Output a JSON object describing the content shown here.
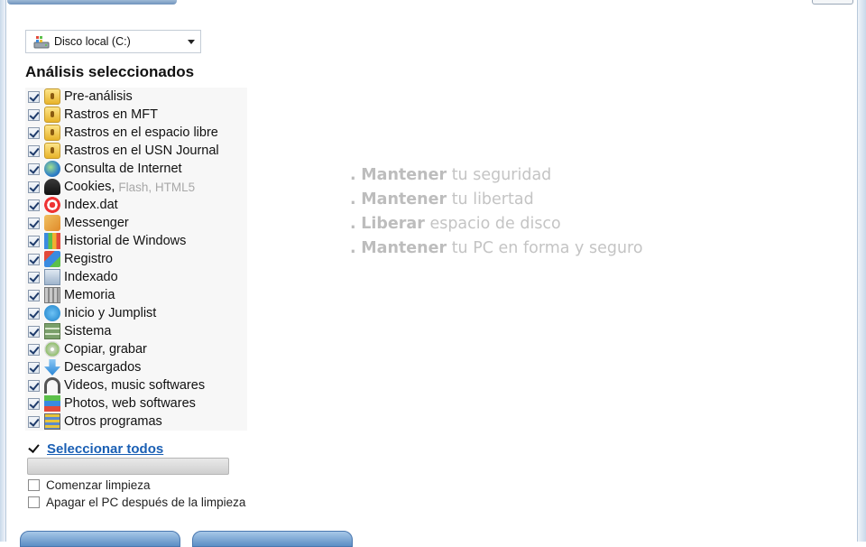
{
  "drive_select": {
    "value": "Disco local (C:)",
    "icon": "hard-drive-icon"
  },
  "analysis": {
    "title": "Análisis seleccionados",
    "items": [
      {
        "label": "Pre-análisis",
        "icon": "lock-icon",
        "checked": true
      },
      {
        "label": "Rastros en MFT",
        "icon": "lock-icon",
        "checked": true
      },
      {
        "label": "Rastros en el espacio libre",
        "icon": "lock-icon",
        "checked": true
      },
      {
        "label": "Rastros en el USN Journal",
        "icon": "lock-icon",
        "checked": true
      },
      {
        "label": "Consulta de Internet",
        "icon": "globe-icon",
        "checked": true
      },
      {
        "label": "Cookies,",
        "sub": "Flash, HTML5",
        "icon": "spy-person-icon",
        "checked": true
      },
      {
        "label": "Index.dat",
        "icon": "target-icon",
        "checked": true
      },
      {
        "label": "Messenger",
        "icon": "messenger-icon",
        "checked": true
      },
      {
        "label": "Historial de Windows",
        "icon": "bar-chart-icon",
        "checked": true
      },
      {
        "label": "Registro",
        "icon": "registry-cubes-icon",
        "checked": true
      },
      {
        "label": "Indexado",
        "icon": "index-icon",
        "checked": true
      },
      {
        "label": "Memoria",
        "icon": "memory-icon",
        "checked": true
      },
      {
        "label": "Inicio y Jumplist",
        "icon": "power-icon",
        "checked": true
      },
      {
        "label": "Sistema",
        "icon": "system-icon",
        "checked": true
      },
      {
        "label": "Copiar, grabar",
        "icon": "disc-icon",
        "checked": true
      },
      {
        "label": "Descargados",
        "icon": "download-arrow-icon",
        "checked": true
      },
      {
        "label": "Videos, music softwares",
        "icon": "headphones-icon",
        "checked": true
      },
      {
        "label": "Photos, web softwares",
        "icon": "photo-icon",
        "checked": true
      },
      {
        "label": "Otros programas",
        "icon": "programs-icon",
        "checked": true
      }
    ]
  },
  "select_all": {
    "label": "Seleccionar todos",
    "checked": true
  },
  "progress": {
    "value": 0
  },
  "options": [
    {
      "label": "Comenzar limpieza",
      "checked": false
    },
    {
      "label": "Apagar el PC después de la limpieza",
      "checked": false
    }
  ],
  "slogans": [
    {
      "bullet": ".",
      "bold": "Mantener",
      "rest": "tu seguridad"
    },
    {
      "bullet": ".",
      "bold": "Mantener",
      "rest": "tu libertad"
    },
    {
      "bullet": ".",
      "bold": "Liberar",
      "rest": "espacio de disco"
    },
    {
      "bullet": ".",
      "bold": "Mantener",
      "rest": "tu PC en forma y seguro"
    }
  ]
}
